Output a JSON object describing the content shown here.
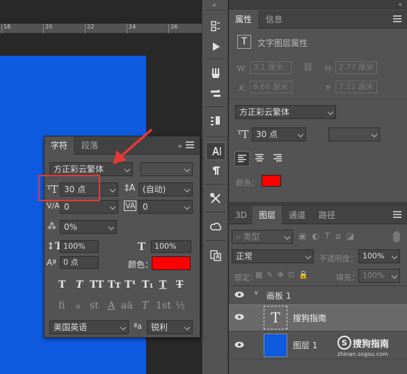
{
  "ruler": {
    "ticks": [
      "18",
      "20",
      "22",
      "24",
      "26"
    ]
  },
  "char_panel": {
    "tabs": [
      "字符",
      "段落"
    ],
    "collapse_glyph": "»",
    "font_family": "方正彩云繁体",
    "font_size": "30 点",
    "leading": "(自动)",
    "kerning": "0",
    "tracking": "0",
    "tsume": "0%",
    "vert_scale": "100%",
    "horiz_scale": "100%",
    "baseline_shift": "0 点",
    "color_label": "颜色：",
    "color_value": "#ff0000",
    "type_styles": [
      "T",
      "T",
      "TT",
      "Tт",
      "T¹",
      "T₁",
      "T",
      "T"
    ],
    "opentype": [
      "fi",
      "ℴ",
      "st",
      "A",
      "aā",
      "T",
      "1st",
      "½"
    ],
    "language": "美国英语",
    "aa_label": "ªa",
    "antialias": "锐利"
  },
  "properties_panel": {
    "tabs": [
      "属性",
      "信息"
    ],
    "collapse_glyph": "«",
    "header": "文字图层属性",
    "w_label": "W:",
    "w_value": "3.1 厘米",
    "h_label": "H:",
    "h_value": "2.77 厘米",
    "x_label": "X:",
    "x_value": "6.66 厘米",
    "y_label": "Y:",
    "y_value": "7.12 厘米",
    "font_family": "方正彩云繁体",
    "font_size": "30 点",
    "color_label": "颜色：",
    "color_value": "#ff0000"
  },
  "layers_panel": {
    "tabs": [
      "3D",
      "图层",
      "通道",
      "路径"
    ],
    "filter_label": "类型",
    "blend_mode": "正常",
    "opacity_label": "不透明度：",
    "opacity_value": "100%",
    "lock_label": "锁定：",
    "fill_label": "填充：",
    "fill_value": "100%",
    "layers": [
      {
        "name": "画板 1",
        "type": "artboard"
      },
      {
        "name": "搜狗指南",
        "type": "text"
      },
      {
        "name": "图层 1",
        "type": "pixel",
        "thumb_color": "#0f5be0"
      }
    ]
  },
  "watermark": {
    "brand": "搜狗指南",
    "url": "zhinan.sogou.com"
  }
}
